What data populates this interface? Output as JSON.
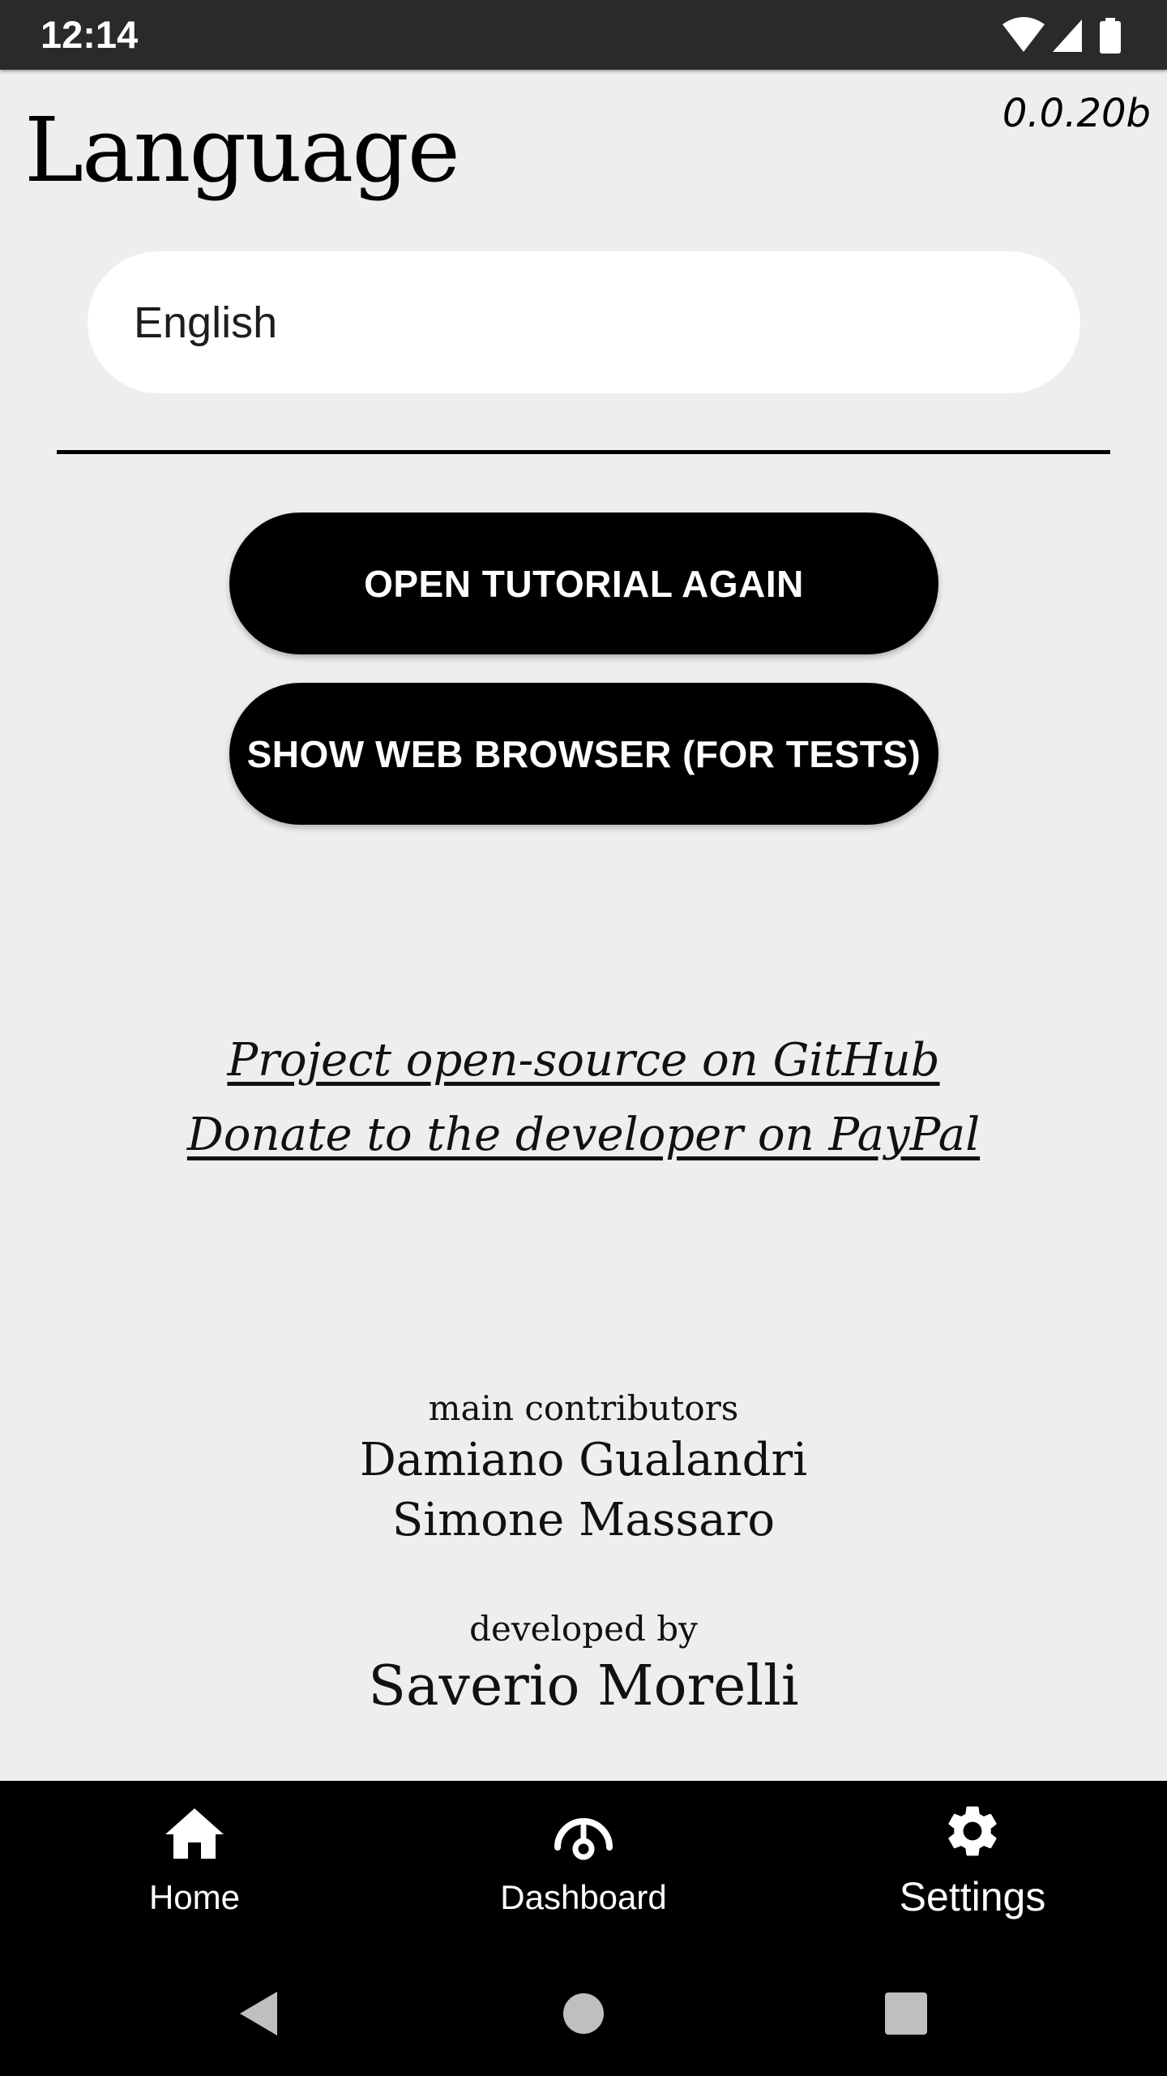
{
  "status_bar": {
    "time": "12:14",
    "icons": [
      "wifi-icon",
      "cellular-signal-icon",
      "battery-icon"
    ]
  },
  "settings": {
    "version": "0.0.20b",
    "title": "Language",
    "language_value": "English"
  },
  "buttons": {
    "open_tutorial": "OPEN TUTORIAL AGAIN",
    "show_browser": "SHOW WEB BROWSER (FOR TESTS)"
  },
  "links": {
    "github": "Project open-source on GitHub",
    "paypal": "Donate to the developer on PayPal"
  },
  "credits": {
    "contributors_label": "main contributors",
    "contributors": [
      "Damiano Gualandri",
      "Simone Massaro"
    ],
    "developer_label": "developed by",
    "developer": "Saverio Morelli"
  },
  "bottom_nav": {
    "items": [
      {
        "label": "Home",
        "icon": "home-icon",
        "active": false
      },
      {
        "label": "Dashboard",
        "icon": "dashboard-icon",
        "active": false
      },
      {
        "label": "Settings",
        "icon": "gear-icon",
        "active": true
      }
    ]
  },
  "system_nav": {
    "buttons": [
      "back-icon",
      "home-circle-icon",
      "recents-icon"
    ]
  },
  "colors": {
    "background": "#eeeeee",
    "status_bar": "#2a2a2a",
    "primary": "#000000",
    "surface": "#ffffff"
  }
}
